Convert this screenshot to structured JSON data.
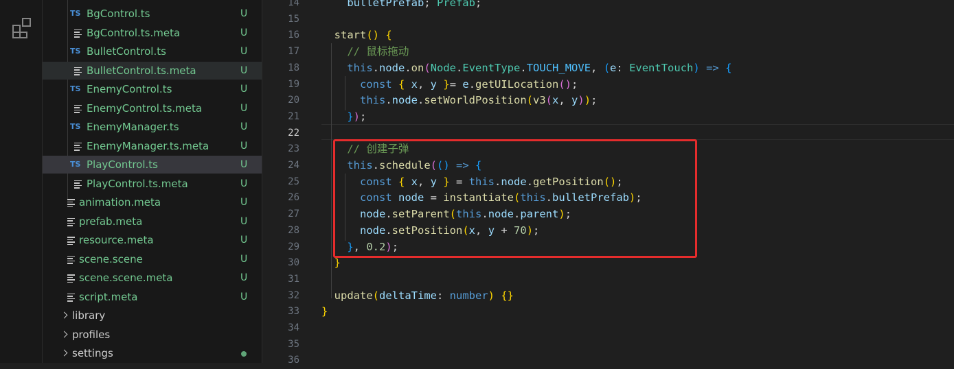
{
  "explorer": {
    "rows": [
      {
        "label": "BgControl.ts",
        "icon": "typescript-file-icon",
        "ts": "TS",
        "status": "U",
        "state": ""
      },
      {
        "label": "BgControl.ts.meta",
        "icon": "meta-file-icon",
        "status": "U",
        "state": ""
      },
      {
        "label": "BulletControl.ts",
        "icon": "typescript-file-icon",
        "ts": "TS",
        "status": "U",
        "state": ""
      },
      {
        "label": "BulletControl.ts.meta",
        "icon": "meta-file-icon",
        "status": "U",
        "state": "hover"
      },
      {
        "label": "EnemyControl.ts",
        "icon": "typescript-file-icon",
        "ts": "TS",
        "status": "U",
        "state": ""
      },
      {
        "label": "EnemyControl.ts.meta",
        "icon": "meta-file-icon",
        "status": "U",
        "state": ""
      },
      {
        "label": "EnemyManager.ts",
        "icon": "typescript-file-icon",
        "ts": "TS",
        "status": "U",
        "state": ""
      },
      {
        "label": "EnemyManager.ts.meta",
        "icon": "meta-file-icon",
        "status": "U",
        "state": ""
      },
      {
        "label": "PlayControl.ts",
        "icon": "typescript-file-icon",
        "ts": "TS",
        "status": "U",
        "state": "selected"
      },
      {
        "label": "PlayControl.ts.meta",
        "icon": "meta-file-icon",
        "status": "U",
        "state": ""
      },
      {
        "label": "animation.meta",
        "icon": "meta-file-icon",
        "status": "U",
        "state": ""
      },
      {
        "label": "prefab.meta",
        "icon": "meta-file-icon",
        "status": "U",
        "state": ""
      },
      {
        "label": "resource.meta",
        "icon": "meta-file-icon",
        "status": "U",
        "state": ""
      },
      {
        "label": "scene.scene",
        "icon": "meta-file-icon",
        "status": "U",
        "state": ""
      },
      {
        "label": "scene.scene.meta",
        "icon": "meta-file-icon",
        "status": "U",
        "state": ""
      },
      {
        "label": "script.meta",
        "icon": "meta-file-icon",
        "status": "U",
        "state": ""
      },
      {
        "label": "library",
        "icon": "chevron-right-icon",
        "status": "",
        "state": ""
      },
      {
        "label": "profiles",
        "icon": "chevron-right-icon",
        "status": "",
        "state": ""
      },
      {
        "label": "settings",
        "icon": "chevron-right-icon",
        "status": "dot",
        "state": ""
      }
    ]
  },
  "editor": {
    "active_line": "22",
    "lines": [
      {
        "n": "14",
        "tokens": [
          [
            "var",
            "    bulletPrefab"
          ],
          [
            "",
            "; "
          ],
          [
            "ty",
            "Prefab"
          ],
          [
            "",
            ";"
          ]
        ]
      },
      {
        "n": "15",
        "tokens": []
      },
      {
        "n": "16",
        "tokens": [
          [
            "fn",
            "  start"
          ],
          [
            "p1",
            "()"
          ],
          [
            "",
            ""
          ],
          [
            "p1",
            " {"
          ]
        ]
      },
      {
        "n": "17",
        "tokens": [
          [
            "cm",
            "    // 鼠标拖动"
          ]
        ]
      },
      {
        "n": "18",
        "tokens": [
          [
            "kw",
            "    this"
          ],
          [
            "",
            "."
          ],
          [
            "var",
            "node"
          ],
          [
            "",
            "."
          ],
          [
            "fn",
            "on"
          ],
          [
            "p2",
            "("
          ],
          [
            "ty",
            "Node"
          ],
          [
            "",
            "."
          ],
          [
            "ty",
            "EventType"
          ],
          [
            "",
            "."
          ],
          [
            "const",
            "TOUCH_MOVE"
          ],
          [
            "",
            ", "
          ],
          [
            "p3",
            "("
          ],
          [
            "var",
            "e"
          ],
          [
            "",
            ": "
          ],
          [
            "ty",
            "EventTouch"
          ],
          [
            "p3",
            ")"
          ],
          [
            "kw",
            " =>"
          ],
          [
            "",
            ""
          ],
          [
            "p3",
            " {"
          ]
        ]
      },
      {
        "n": "19",
        "tokens": [
          [
            "kw",
            "      const"
          ],
          [
            "p1",
            " {"
          ],
          [
            "var",
            " x"
          ],
          [
            "",
            ","
          ],
          [
            "var",
            " y"
          ],
          [
            "p1",
            " }"
          ],
          [
            "",
            "",
            " "
          ],
          [
            "",
            "= "
          ],
          [
            "var",
            "e"
          ],
          [
            "",
            "."
          ],
          [
            "fn",
            "getUILocation"
          ],
          [
            "p2",
            "()"
          ],
          [
            "",
            ";"
          ]
        ]
      },
      {
        "n": "20",
        "tokens": [
          [
            "kw",
            "      this"
          ],
          [
            "",
            "."
          ],
          [
            "var",
            "node"
          ],
          [
            "",
            "."
          ],
          [
            "fn",
            "setWorldPosition"
          ],
          [
            "p1",
            "("
          ],
          [
            "fn",
            "v3"
          ],
          [
            "p2",
            "("
          ],
          [
            "var",
            "x"
          ],
          [
            "",
            ", "
          ],
          [
            "var",
            "y"
          ],
          [
            "p2",
            ")"
          ],
          [
            "p1",
            ")"
          ],
          [
            "",
            ";"
          ]
        ]
      },
      {
        "n": "21",
        "tokens": [
          [
            "p3",
            "    }"
          ],
          [
            "p2",
            ")"
          ],
          [
            "",
            ";"
          ]
        ]
      },
      {
        "n": "22",
        "tokens": []
      },
      {
        "n": "23",
        "tokens": [
          [
            "cm",
            "    // 创建子弹"
          ]
        ]
      },
      {
        "n": "24",
        "tokens": [
          [
            "kw",
            "    this"
          ],
          [
            "",
            "."
          ],
          [
            "fn",
            "schedule"
          ],
          [
            "p2",
            "("
          ],
          [
            "p3",
            "()"
          ],
          [
            "kw",
            " =>"
          ],
          [
            "p3",
            " {"
          ]
        ]
      },
      {
        "n": "25",
        "tokens": [
          [
            "kw",
            "      const"
          ],
          [
            "p1",
            " {"
          ],
          [
            "var",
            " x"
          ],
          [
            "",
            ","
          ],
          [
            "var",
            " y"
          ],
          [
            "p1",
            " }"
          ],
          [
            "",
            " = "
          ],
          [
            "kw",
            "this"
          ],
          [
            "",
            "."
          ],
          [
            "var",
            "node"
          ],
          [
            "",
            "."
          ],
          [
            "fn",
            "getPosition"
          ],
          [
            "p1",
            "()"
          ],
          [
            "",
            ";"
          ]
        ]
      },
      {
        "n": "26",
        "tokens": [
          [
            "kw",
            "      const"
          ],
          [
            "var",
            " node"
          ],
          [
            "",
            " = "
          ],
          [
            "fn",
            "instantiate"
          ],
          [
            "p1",
            "("
          ],
          [
            "kw",
            "this"
          ],
          [
            "",
            "."
          ],
          [
            "var",
            "bulletPrefab"
          ],
          [
            "p1",
            ")"
          ],
          [
            "",
            ";"
          ]
        ]
      },
      {
        "n": "27",
        "tokens": [
          [
            "var",
            "      node"
          ],
          [
            "",
            "."
          ],
          [
            "fn",
            "setParent"
          ],
          [
            "p1",
            "("
          ],
          [
            "kw",
            "this"
          ],
          [
            "",
            "."
          ],
          [
            "var",
            "node"
          ],
          [
            "",
            "."
          ],
          [
            "var",
            "parent"
          ],
          [
            "p1",
            ")"
          ],
          [
            "",
            ";"
          ]
        ]
      },
      {
        "n": "28",
        "tokens": [
          [
            "var",
            "      node"
          ],
          [
            "",
            "."
          ],
          [
            "fn",
            "setPosition"
          ],
          [
            "p1",
            "("
          ],
          [
            "var",
            "x"
          ],
          [
            "",
            ", "
          ],
          [
            "var",
            "y"
          ],
          [
            "",
            " + "
          ],
          [
            "num",
            "70"
          ],
          [
            "p1",
            ")"
          ],
          [
            "",
            ";"
          ]
        ]
      },
      {
        "n": "29",
        "tokens": [
          [
            "p3",
            "    }"
          ],
          [
            "",
            ", "
          ],
          [
            "num",
            "0.2"
          ],
          [
            "p2",
            ")"
          ],
          [
            "",
            ";"
          ]
        ]
      },
      {
        "n": "30",
        "tokens": [
          [
            "p1",
            "  }"
          ]
        ]
      },
      {
        "n": "31",
        "tokens": []
      },
      {
        "n": "32",
        "tokens": [
          [
            "fn",
            "  update"
          ],
          [
            "p1",
            "("
          ],
          [
            "var",
            "deltaTime"
          ],
          [
            "",
            ": "
          ],
          [
            "kw",
            "number"
          ],
          [
            "p1",
            ")"
          ],
          [
            "p1",
            " {}"
          ]
        ]
      },
      {
        "n": "33",
        "tokens": [
          [
            "p1",
            "}"
          ]
        ]
      },
      {
        "n": "34",
        "tokens": []
      },
      {
        "n": "35",
        "tokens": []
      },
      {
        "n": "36",
        "tokens": []
      }
    ]
  }
}
